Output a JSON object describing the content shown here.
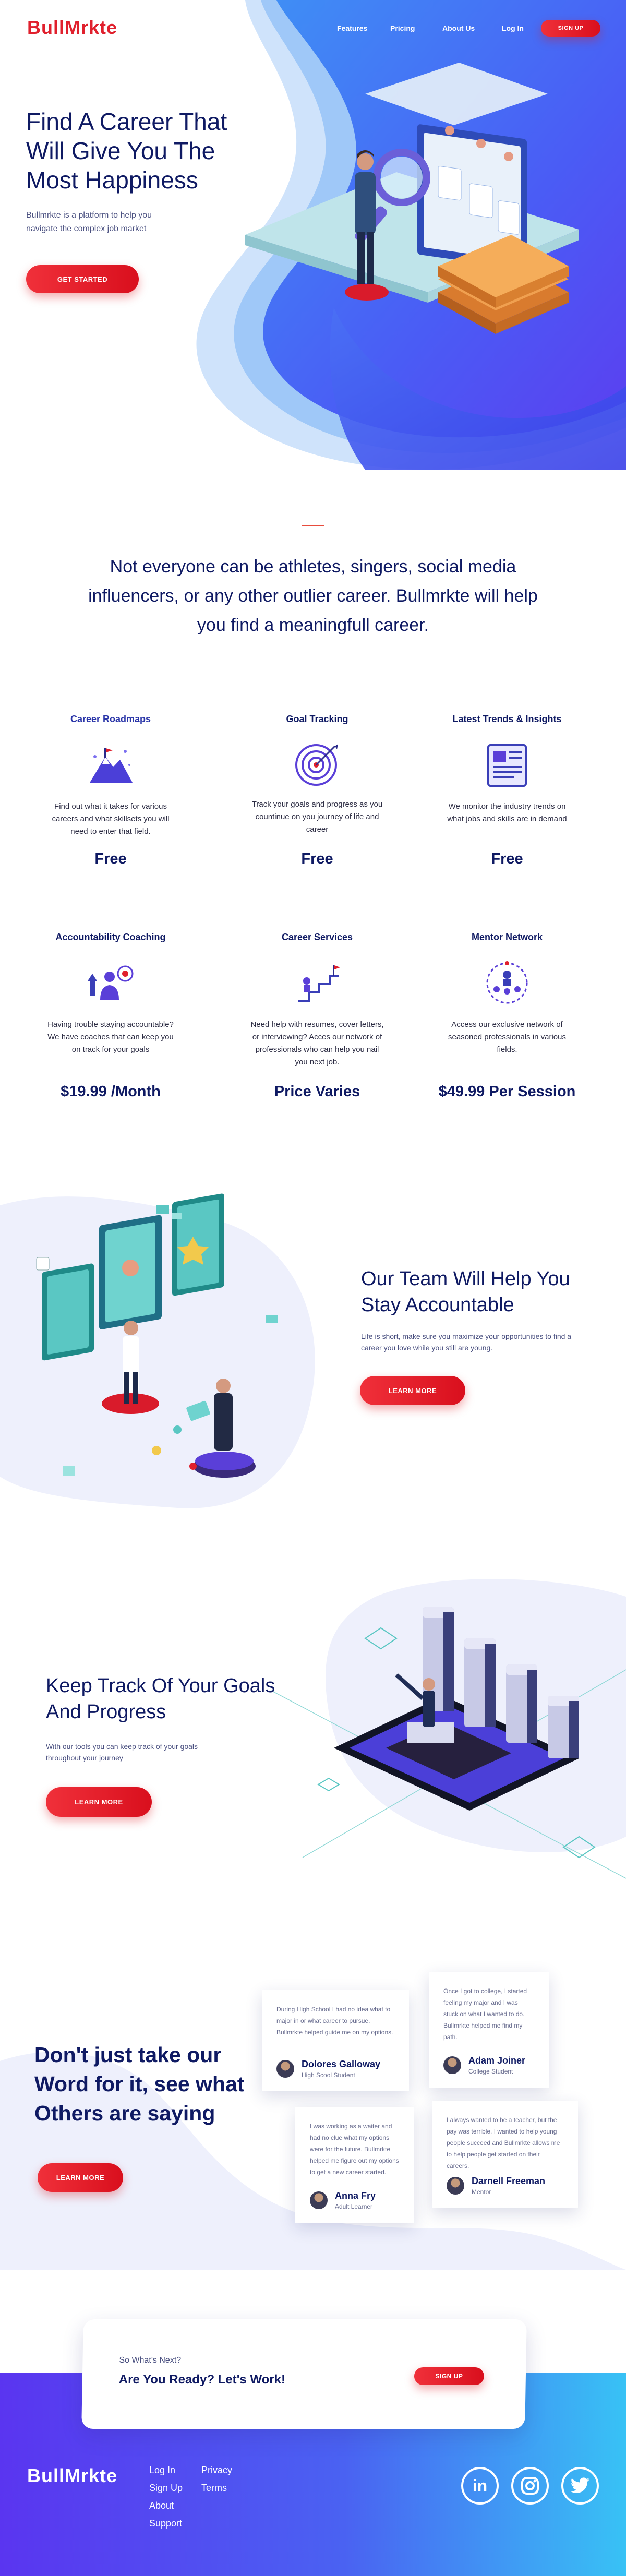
{
  "brand": {
    "logo_text": "BullMrkte",
    "accent": "#e0202d",
    "navy": "#0f1a63",
    "blue": "#4a5cf5"
  },
  "nav": {
    "items": [
      "Features",
      "Pricing",
      "About Us",
      "Log In"
    ],
    "signup": "SIGN UP"
  },
  "hero": {
    "title": "Find A Career That Will Give You The Most Happiness",
    "subtitle": "Bullmrkte is a platform to help you navigate the complex job market",
    "cta": "GET STARTED"
  },
  "intro": {
    "text": "Not everyone can be athletes, singers, social media influencers, or any other outlier career. Bullmrkte will help you find a meaningfull career."
  },
  "features": [
    {
      "title": "Career Roadmaps",
      "desc": "Find out what it takes for various careers and what skillsets you will need to enter that field.",
      "price": "Free",
      "icon": "roadmap-mountain-icon"
    },
    {
      "title": "Goal Tracking",
      "desc": "Track your goals and progress as you countinue on you journey of life and career",
      "price": "Free",
      "icon": "target-icon"
    },
    {
      "title": "Latest Trends & Insights",
      "desc": "We monitor the industry trends on what jobs and skills are in demand",
      "price": "Free",
      "icon": "newspaper-icon"
    },
    {
      "title": "Accountability Coaching",
      "desc": "Having trouble staying accountable? We have coaches that can keep you on track for your goals",
      "price": "$19.99 /Month",
      "icon": "coach-target-icon"
    },
    {
      "title": "Career Services",
      "desc": "Need help with resumes, cover letters, or interviewing? Acces our network of professionals who can help you nail you next job.",
      "price": "Price Varies",
      "icon": "career-stairs-icon"
    },
    {
      "title": "Mentor Network",
      "desc": "Access our exclusive network of seasoned professionals in various fields.",
      "price": "$49.99 Per Session",
      "icon": "mentor-network-icon"
    }
  ],
  "team": {
    "title": "Our Team Will Help You Stay Accountable",
    "text": "Life is short, make sure you maximize your opportunities to find a career you love while you still are young.",
    "cta": "LEARN MORE"
  },
  "track": {
    "title": "Keep Track Of Your Goals And Progress",
    "text": "With our tools you can keep track of your goals throughout your journey",
    "cta": "LEARN MORE"
  },
  "testimonials": {
    "title": "Don't just take our Word for it, see what Others are saying",
    "cta": "LEARN MORE",
    "items": [
      {
        "quote": "During High School I had no idea what to major in or what career to pursue. Bullmrkte helped guide me on my options.",
        "name": "Dolores Galloway",
        "role": "High Scool Student"
      },
      {
        "quote": "Once I got to college, I started feeling my major and I was stuck on what I wanted to do. Bullmrkte helped me find my path.",
        "name": "Adam Joiner",
        "role": "College Student"
      },
      {
        "quote": "I was working as a waiter and had no clue what my options were for the future. Bullmrkte helped me figure out my options to get a new career started.",
        "name": "Anna Fry",
        "role": "Adult Learner"
      },
      {
        "quote": "I always wanted to be a teacher, but the pay was terrible. I wanted to help young people succeed and Bullmrkte allows me to help people get started on their careers.",
        "name": "Darnell Freeman",
        "role": "Mentor"
      }
    ]
  },
  "cta_box": {
    "eyebrow": "So What's Next?",
    "title": "Are You Ready? Let's Work!",
    "button": "SIGN UP"
  },
  "footer": {
    "logo_text": "BullMrkte",
    "col1": [
      "Log In",
      "Sign Up",
      "About",
      "Support"
    ],
    "col2": [
      "Privacy",
      "Terms"
    ],
    "social": [
      {
        "icon": "linkedin-icon",
        "label": "in"
      },
      {
        "icon": "instagram-icon",
        "label": ""
      },
      {
        "icon": "twitter-icon",
        "label": ""
      }
    ]
  }
}
